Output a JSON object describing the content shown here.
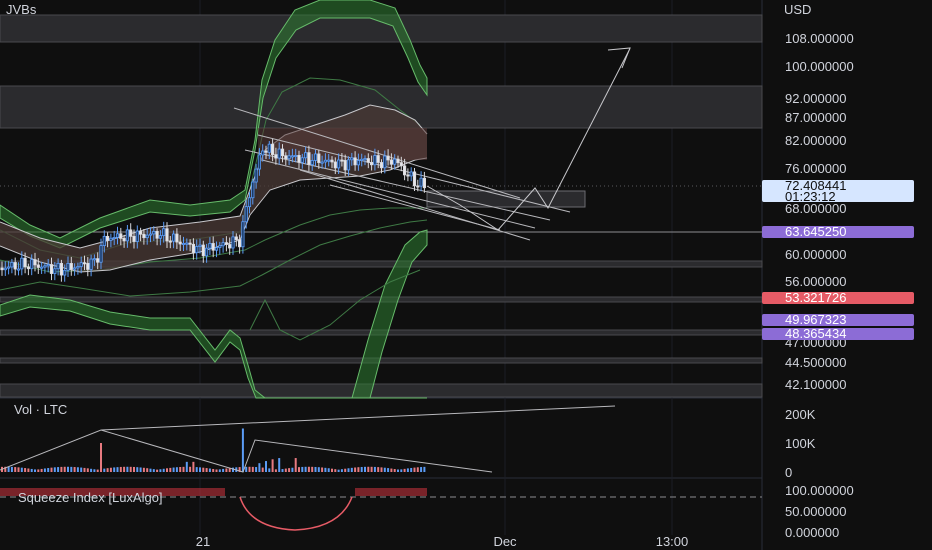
{
  "header": {
    "symbol": "JVBs"
  },
  "price_axis": {
    "currency": "USD",
    "ticks": [
      "108.000000",
      "100.000000",
      "92.000000",
      "87.000000",
      "82.000000",
      "76.000000",
      "68.000000",
      "60.000000",
      "56.000000",
      "47.000000",
      "44.500000",
      "42.100000"
    ],
    "badges": [
      {
        "label": "72.408441",
        "sublabel": "01:23:12",
        "color": "#d6e6ff",
        "text_color": "#0f0f0f"
      },
      {
        "label": "63.645250",
        "color": "#8c6cd6",
        "text_color": "#ffffff"
      },
      {
        "label": "53.321726",
        "color": "#e65b66",
        "text_color": "#ffffff"
      },
      {
        "label": "49.967323",
        "color": "#8c6cd6",
        "text_color": "#ffffff"
      },
      {
        "label": "48.365434",
        "color": "#8c6cd6",
        "text_color": "#ffffff"
      }
    ]
  },
  "volume_pane": {
    "title": "Vol · LTC",
    "ticks": [
      "200K",
      "100K",
      "0"
    ]
  },
  "indicator_pane": {
    "title": "Squeeze Index [LuxAlgo]",
    "ticks": [
      "100.000000",
      "50.000000",
      "0.000000"
    ]
  },
  "time_axis": {
    "ticks": [
      "21",
      "Dec",
      "13:00"
    ]
  },
  "chart_data": {
    "type": "candlestick",
    "currency": "USD",
    "last_price": 72.408441,
    "countdown": "01:23:12",
    "price_range": [
      42.1,
      108
    ],
    "marked_levels": [
      63.64525,
      53.321726,
      49.967323,
      48.365434
    ],
    "volume_range": [
      0,
      200000
    ],
    "volume_peak": 150000,
    "squeeze_index_range": [
      0,
      100
    ],
    "x_ticks": [
      "21",
      "Dec",
      "13:00"
    ],
    "projection": {
      "from": 68,
      "to": 105
    },
    "colors": {
      "up": "#5b9cf6",
      "down": "#e87a80",
      "band": "#2e7d32",
      "band_line": "#66bb6a",
      "accent": "#8c6cd6",
      "bear": "#e65b66",
      "background": "#0f0f0f"
    }
  }
}
